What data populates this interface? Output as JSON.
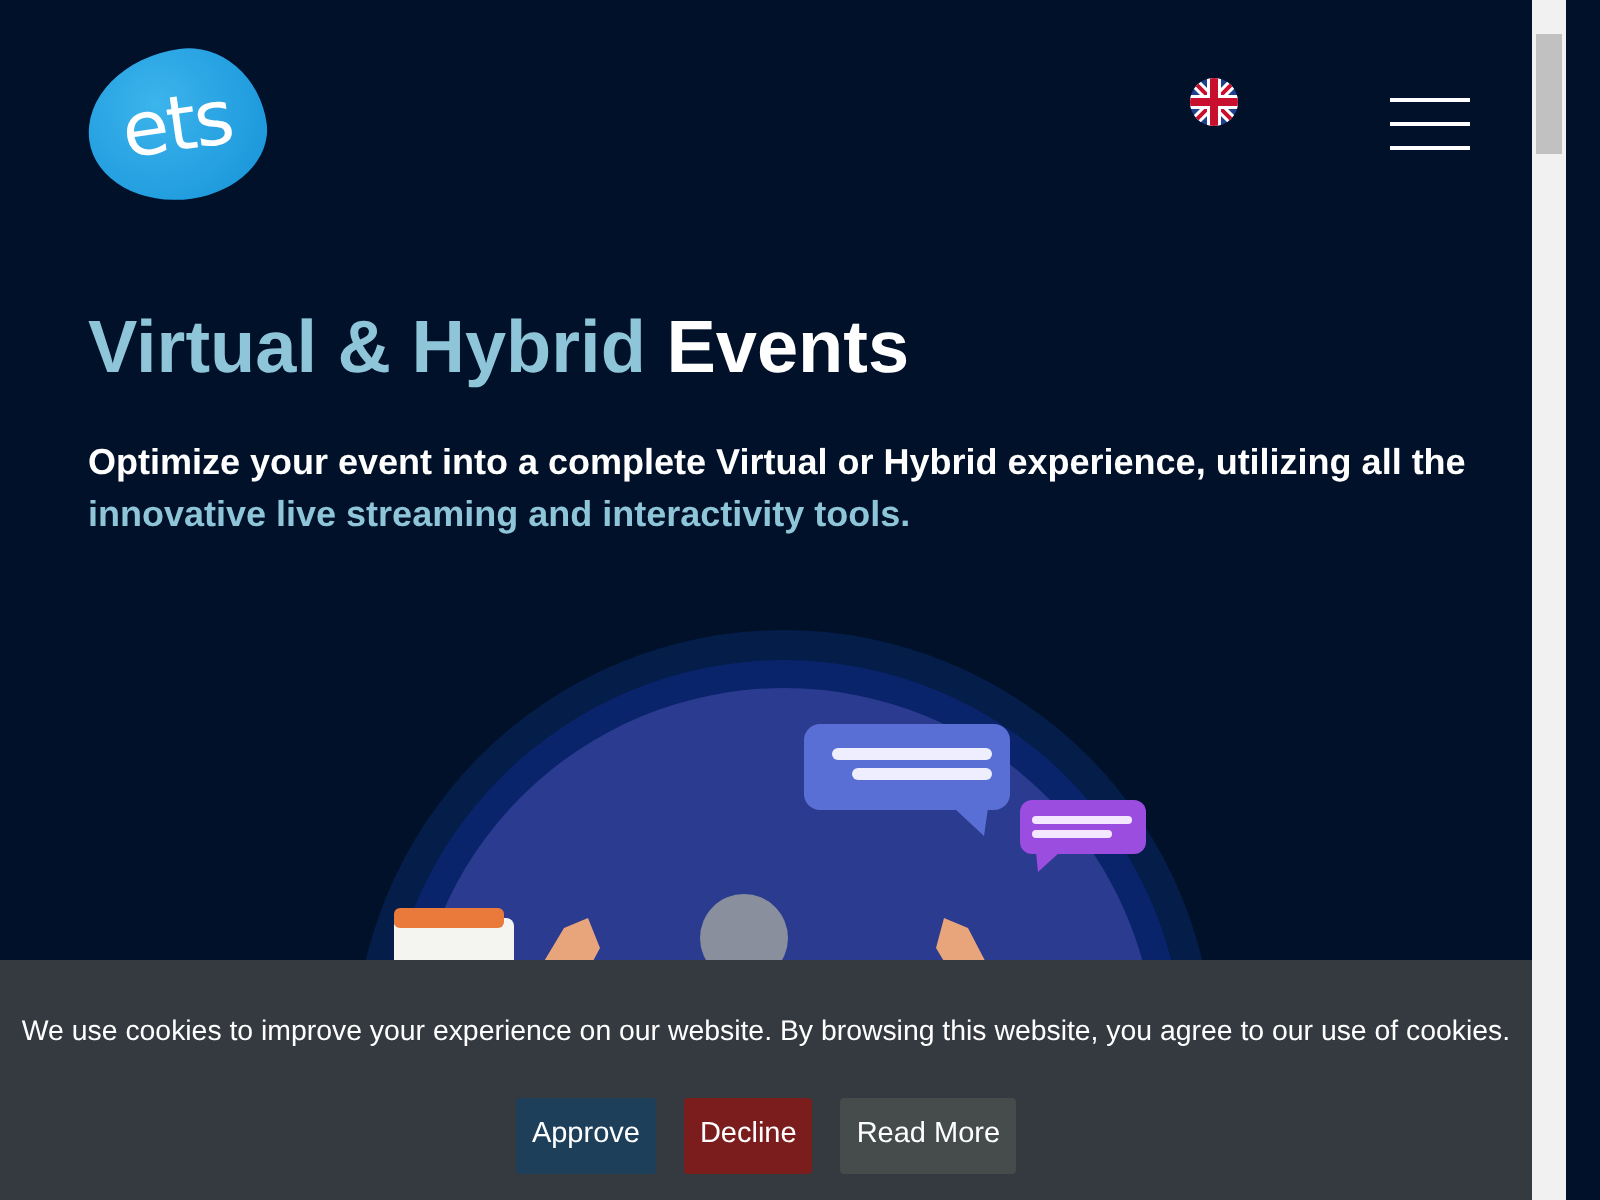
{
  "header": {
    "logo": "ets"
  },
  "hero": {
    "title_highlight": "Virtual & Hybrid",
    "title_rest": "Events",
    "subtitle_text": "Optimize your event into a complete Virtual or Hybrid experience, utilizing all the",
    "subtitle_highlight": "innovative live streaming and interactivity tools."
  },
  "cookie_banner": {
    "message": "We use cookies to improve your experience on our website. By browsing this website, you agree to our use of cookies.",
    "buttons": [
      {
        "label": "Approve",
        "kind": "approve"
      },
      {
        "label": "Decline",
        "kind": "decline"
      },
      {
        "label": "Read More",
        "kind": "more"
      }
    ]
  }
}
